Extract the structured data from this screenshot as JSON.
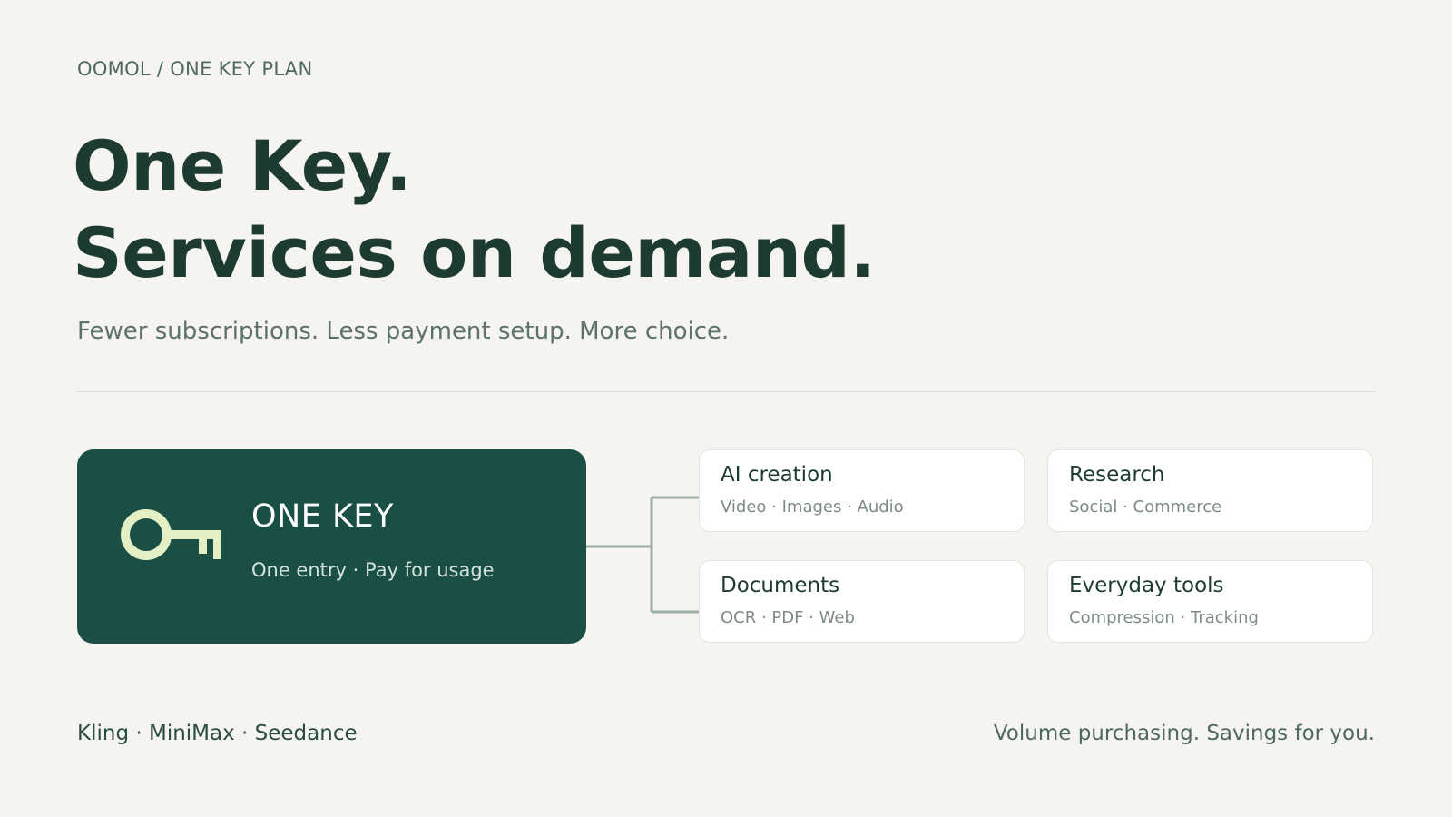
{
  "breadcrumb": "OOMOL / ONE KEY PLAN",
  "headline": {
    "line1": "One Key.",
    "line2": "Services on demand."
  },
  "subtitle": "Fewer subscriptions. Less payment setup. More choice.",
  "key_card": {
    "title": "ONE KEY",
    "subtitle": "One entry · Pay for usage",
    "icon": "key-icon"
  },
  "services": [
    {
      "title": "AI creation",
      "subtitle": "Video · Images · Audio"
    },
    {
      "title": "Research",
      "subtitle": "Social · Commerce"
    },
    {
      "title": "Documents",
      "subtitle": "OCR · PDF · Web"
    },
    {
      "title": "Everyday tools",
      "subtitle": "Compression · Tracking"
    }
  ],
  "footer": {
    "partners": "Kling · MiniMax · Seedance",
    "tagline": "Volume purchasing. Savings for you."
  },
  "colors": {
    "background": "#f5f4f0",
    "card": "#1a4f46",
    "key": "#e4f0c4",
    "connector": "#9ab0a6"
  }
}
